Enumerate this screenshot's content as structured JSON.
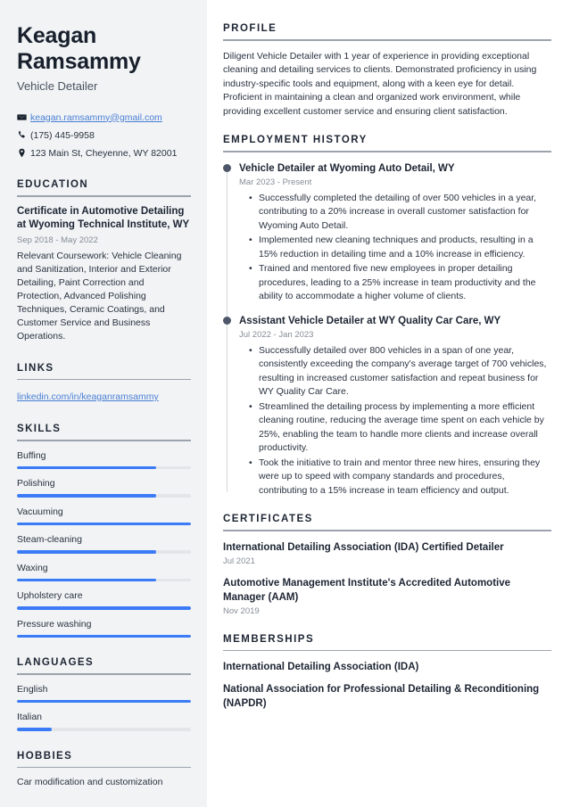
{
  "sidebar": {
    "name": "Keagan Ramsammy",
    "job_title": "Vehicle Detailer",
    "contact": {
      "email": "keagan.ramsammy@gmail.com",
      "phone": "(175) 445-9958",
      "address": "123 Main St, Cheyenne, WY 82001",
      "email_icon": "envelope-icon",
      "phone_icon": "phone-icon",
      "address_icon": "location-pin-icon"
    },
    "education": {
      "heading": "EDUCATION",
      "items": [
        {
          "degree": "Certificate in Automotive Detailing at Wyoming Technical Institute, WY",
          "date": "Sep 2018 - May 2022",
          "description": "Relevant Coursework: Vehicle Cleaning and Sanitization, Interior and Exterior Detailing, Paint Correction and Protection, Advanced Polishing Techniques, Ceramic Coatings, and Customer Service and Business Operations."
        }
      ]
    },
    "links": {
      "heading": "LINKS",
      "items": [
        {
          "label": "linkedin.com/in/keaganramsammy"
        }
      ]
    },
    "skills": {
      "heading": "SKILLS",
      "items": [
        {
          "label": "Buffing",
          "level": 80
        },
        {
          "label": "Polishing",
          "level": 80
        },
        {
          "label": "Vacuuming",
          "level": 100
        },
        {
          "label": "Steam-cleaning",
          "level": 80
        },
        {
          "label": "Waxing",
          "level": 80
        },
        {
          "label": "Upholstery care",
          "level": 100
        },
        {
          "label": "Pressure washing",
          "level": 100
        }
      ]
    },
    "languages": {
      "heading": "LANGUAGES",
      "items": [
        {
          "label": "English",
          "level": 100
        },
        {
          "label": "Italian",
          "level": 20
        }
      ]
    },
    "hobbies": {
      "heading": "HOBBIES",
      "items": [
        {
          "label": "Car modification and customization"
        }
      ]
    }
  },
  "main": {
    "profile": {
      "heading": "PROFILE",
      "text": "Diligent Vehicle Detailer with 1 year of experience in providing exceptional cleaning and detailing services to clients. Demonstrated proficiency in using industry-specific tools and equipment, along with a keen eye for detail. Proficient in maintaining a clean and organized work environment, while providing excellent customer service and ensuring client satisfaction."
    },
    "employment": {
      "heading": "EMPLOYMENT HISTORY",
      "jobs": [
        {
          "role": "Vehicle Detailer at Wyoming Auto Detail, WY",
          "date": "Mar 2023 - Present",
          "bullets": [
            "Successfully completed the detailing of over 500 vehicles in a year, contributing to a 20% increase in overall customer satisfaction for Wyoming Auto Detail.",
            "Implemented new cleaning techniques and products, resulting in a 15% reduction in detailing time and a 10% increase in efficiency.",
            "Trained and mentored five new employees in proper detailing procedures, leading to a 25% increase in team productivity and the ability to accommodate a higher volume of clients."
          ]
        },
        {
          "role": "Assistant Vehicle Detailer at WY Quality Car Care, WY",
          "date": "Jul 2022 - Jan 2023",
          "bullets": [
            "Successfully detailed over 800 vehicles in a span of one year, consistently exceeding the company's average target of 700 vehicles, resulting in increased customer satisfaction and repeat business for WY Quality Car Care.",
            "Streamlined the detailing process by implementing a more efficient cleaning routine, reducing the average time spent on each vehicle by 25%, enabling the team to handle more clients and increase overall productivity.",
            "Took the initiative to train and mentor three new hires, ensuring they were up to speed with company standards and procedures, contributing to a 15% increase in team efficiency and output."
          ]
        }
      ]
    },
    "certificates": {
      "heading": "CERTIFICATES",
      "items": [
        {
          "name": "International Detailing Association (IDA) Certified Detailer",
          "date": "Jul 2021"
        },
        {
          "name": "Automotive Management Institute's Accredited Automotive Manager (AAM)",
          "date": "Nov 2019"
        }
      ]
    },
    "memberships": {
      "heading": "MEMBERSHIPS",
      "items": [
        {
          "name": "International Detailing Association (IDA)"
        },
        {
          "name": "National Association for Professional Detailing & Reconditioning (NAPDR)"
        }
      ]
    }
  },
  "theme": {
    "accent": "#3b7bf6",
    "link": "#4a7fd4",
    "heading": "#1d2533",
    "sidebar_bg": "#f1f3f5",
    "muted": "#868d97"
  }
}
